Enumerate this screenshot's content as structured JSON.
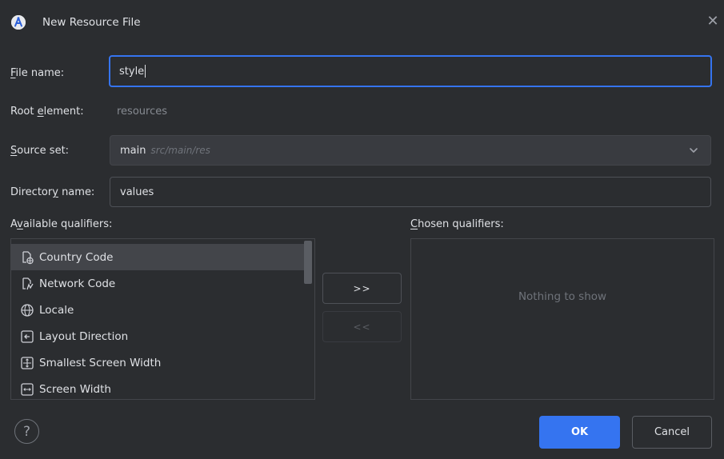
{
  "window": {
    "title": "New Resource File",
    "close_glyph": "✕"
  },
  "form": {
    "file_name": {
      "label_mnemonic": "F",
      "label_rest": "ile name:",
      "value": "style"
    },
    "root_element": {
      "label_pre": "Root ",
      "label_mnemonic": "e",
      "label_post": "lement:",
      "value": "resources"
    },
    "source_set": {
      "label_mnemonic": "S",
      "label_rest": "ource set:",
      "value": "main",
      "path": "src/main/res"
    },
    "directory_name": {
      "label_pre": "Director",
      "label_mnemonic": "y",
      "label_post": " name:",
      "value": "values"
    }
  },
  "available": {
    "label_pre": "A",
    "label_mnemonic": "v",
    "label_post": "ailable qualifiers:",
    "items": [
      {
        "label": "Country Code",
        "icon": "country-code-icon"
      },
      {
        "label": "Network Code",
        "icon": "network-code-icon"
      },
      {
        "label": "Locale",
        "icon": "globe-icon"
      },
      {
        "label": "Layout Direction",
        "icon": "layout-direction-icon"
      },
      {
        "label": "Smallest Screen Width",
        "icon": "smallest-screen-width-icon"
      },
      {
        "label": "Screen Width",
        "icon": "screen-width-icon"
      }
    ]
  },
  "transfer": {
    "add_label": ">>",
    "remove_label": "<<"
  },
  "chosen": {
    "label_mnemonic": "C",
    "label_rest": "hosen qualifiers:",
    "empty_text": "Nothing to show"
  },
  "footer": {
    "help_glyph": "?",
    "ok_label": "OK",
    "cancel_label": "Cancel"
  },
  "colors": {
    "background": "#2b2d30",
    "accent": "#3574f0",
    "field": "#393b40",
    "border": "#4e5157"
  }
}
